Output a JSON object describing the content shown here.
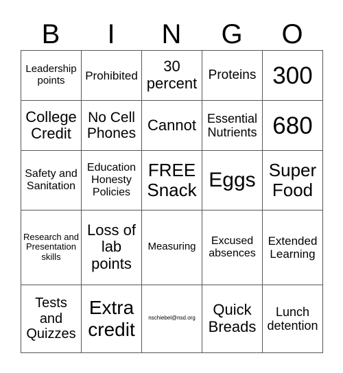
{
  "header": [
    "B",
    "I",
    "N",
    "G",
    "O"
  ],
  "rows": [
    [
      "Leadership points",
      "Prohibited",
      "30 percent",
      "Proteins",
      "300"
    ],
    [
      "College Credit",
      "No Cell Phones",
      "Cannot",
      "Essential Nutrients",
      "680"
    ],
    [
      "Safety and Sanitation",
      "Education Honesty Policies",
      "FREE Snack",
      "Eggs",
      "Super Food"
    ],
    [
      "Research and Presentation skills",
      "Loss of lab points",
      "Measuring",
      "Excused absences",
      "Extended Learning"
    ],
    [
      "Tests and Quizzes",
      "Extra credit",
      "nschiebel@nsd.org",
      "Quick Breads",
      "Lunch detention"
    ]
  ]
}
